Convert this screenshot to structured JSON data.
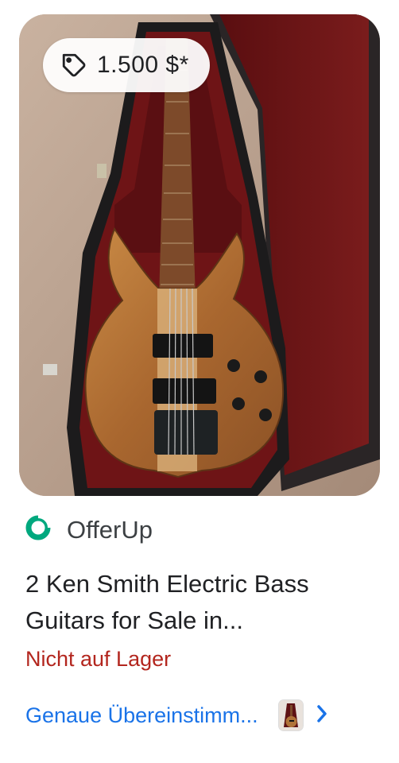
{
  "listing": {
    "price": "1.500 $*",
    "source_name": "OfferUp",
    "title": "2 Ken Smith Electric Bass Guitars for Sale in...",
    "stock_status": "Nicht auf Lager",
    "match_link": "Genaue Übereinstimm..."
  },
  "icons": {
    "price_tag": "tag-icon",
    "source_logo": "offerup-logo-icon",
    "chevron": "chevron-right-icon",
    "thumbnail": "bass-guitar-thumbnail"
  },
  "colors": {
    "source_logo": "#00a87e",
    "stock_status": "#b3261e",
    "link": "#1a73e8",
    "case_lining": "#6e1416",
    "guitar_wood": "#b0743a"
  }
}
